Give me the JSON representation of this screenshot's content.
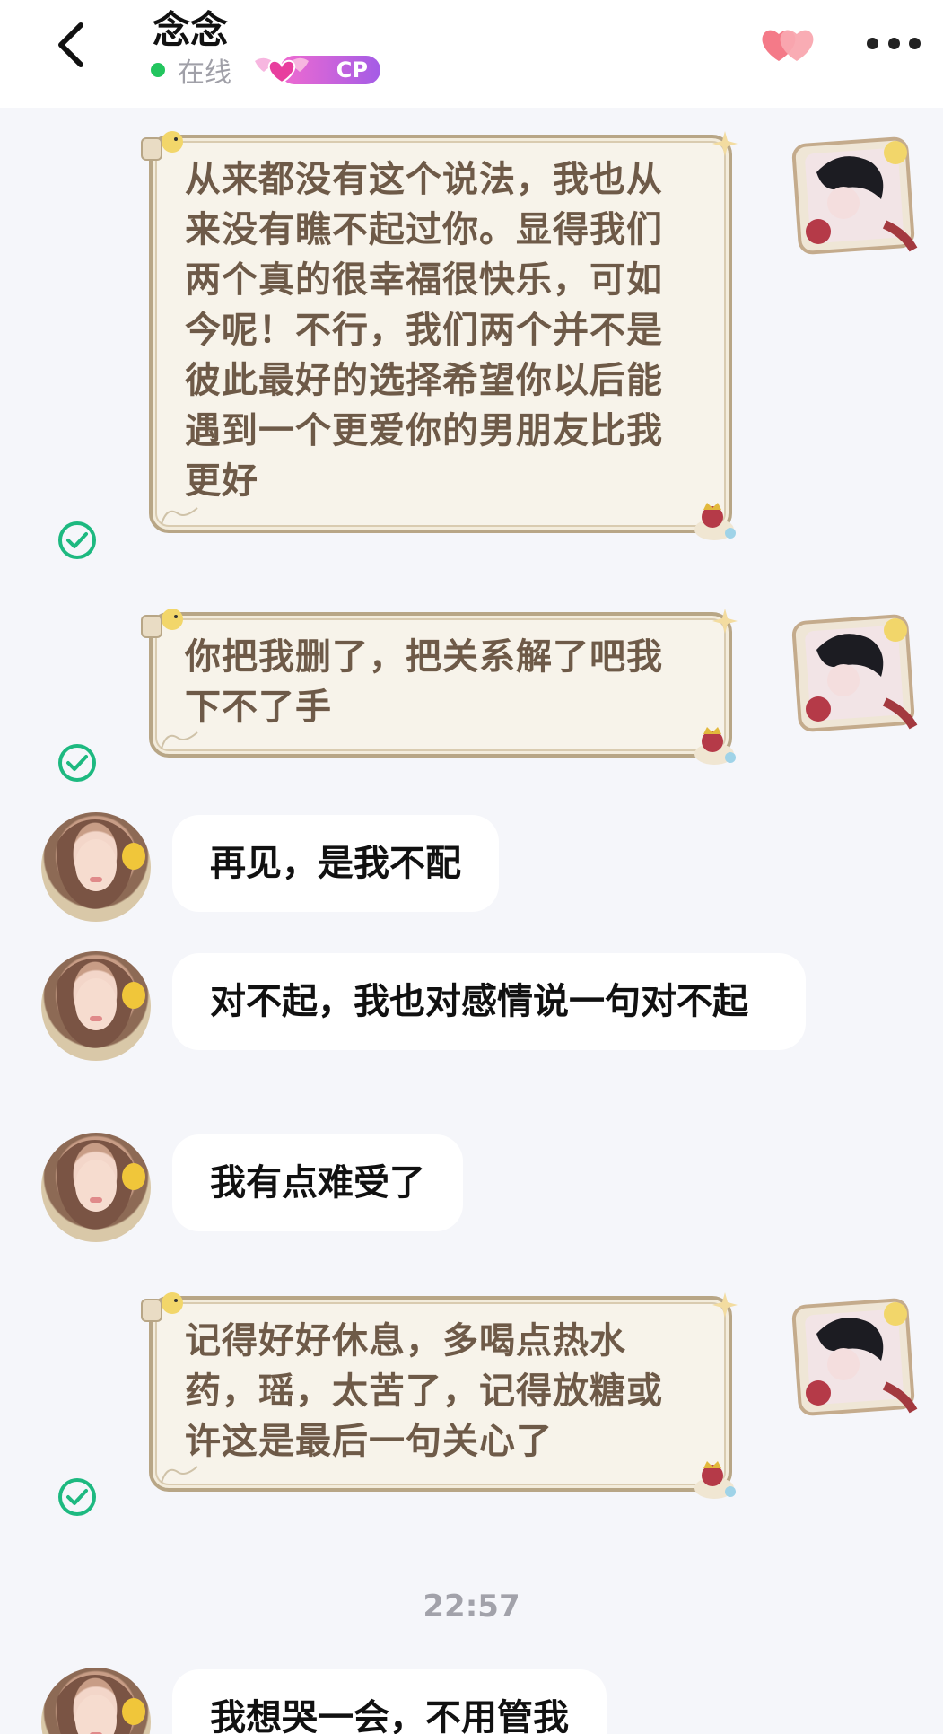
{
  "header": {
    "title": "念念",
    "status": "在线",
    "cp_label": "CP"
  },
  "colors": {
    "online": "#22c55e",
    "check": "#1db980",
    "bubble_text": "#6e5a48"
  },
  "messages": [
    {
      "type": "out",
      "text": "从来都没有这个说法，我也从来没有瞧不起过你。显得我们两个真的很幸福很快乐，可如今呢！不行，我们两个并不是彼此最好的选择希望你以后能遇到一个更爱你的男朋友比我更好"
    },
    {
      "type": "out",
      "text": "你把我删了，把关系解了吧我下不了手"
    },
    {
      "type": "in",
      "text": "再见，是我不配"
    },
    {
      "type": "in",
      "text": "对不起，我也对感情说一句对不起"
    },
    {
      "type": "in",
      "text": "我有点难受了"
    },
    {
      "type": "out",
      "text": "记得好好休息，多喝点热水药，瑶，太苦了，记得放糖或许这是最后一句关心了"
    },
    {
      "type": "time",
      "text": "22:57"
    },
    {
      "type": "in",
      "text": "我想哭一会，不用管我"
    }
  ]
}
